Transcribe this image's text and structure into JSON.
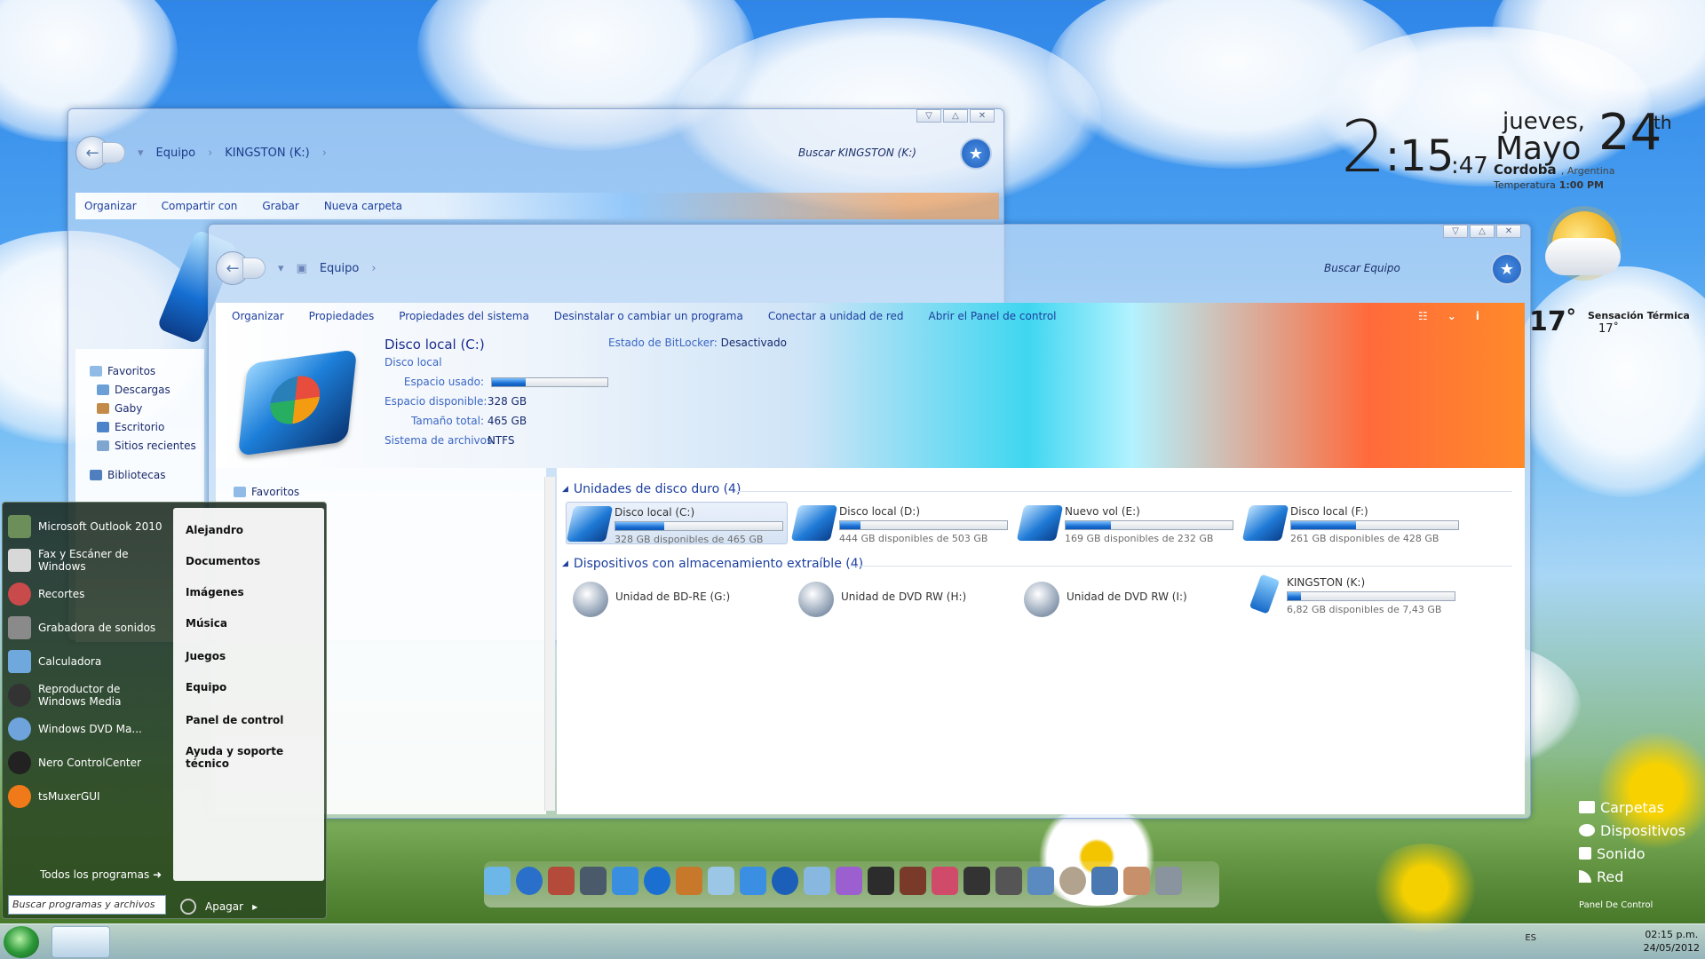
{
  "clock": {
    "hour": "2",
    "minsec": ":15",
    "sec": ":47",
    "day_name": "jueves,",
    "month": "Mayo",
    "day_num": "24",
    "suffix": "th",
    "city": "Cordoba",
    "country": ", Argentina",
    "temp_label": "Temperatura",
    "temp_time": "1:00 PM"
  },
  "weather": {
    "temp": "17",
    "deg": "°",
    "feels_label": "Sensación Térmica",
    "feels_value": "17˚"
  },
  "quicklinks": {
    "items": [
      "Carpetas",
      "Dispositivos",
      "Sonido",
      "Red"
    ],
    "panel": "Panel De Control"
  },
  "win_kingston": {
    "crumbs": [
      "Equipo",
      "KINGSTON (K:)"
    ],
    "search": "Buscar KINGSTON (K:)",
    "cmd": [
      "Organizar",
      "Compartir con",
      "Grabar",
      "Nueva carpeta"
    ],
    "side_groups": [
      {
        "label": "Favoritos",
        "items": [
          "Descargas",
          "Gaby",
          "Escritorio",
          "Sitios recientes"
        ]
      },
      {
        "label": "Bibliotecas"
      }
    ]
  },
  "win_equipo": {
    "crumbs": [
      "Equipo"
    ],
    "search": "Buscar Equipo",
    "cmd": [
      "Organizar",
      "Propiedades",
      "Propiedades del sistema",
      "Desinstalar o cambiar un programa",
      "Conectar a unidad de red",
      "Abrir el Panel de control"
    ],
    "details": {
      "title": "Disco local (C:)",
      "subtitle": "Disco local",
      "used_label": "Espacio usado:",
      "used_fraction": 0.29,
      "free_label": "Espacio disponible:",
      "free_value": "328 GB",
      "total_label": "Tamaño total:",
      "total_value": "465 GB",
      "fs_label": "Sistema de archivos:",
      "fs_value": "NTFS",
      "bitlocker_label": "Estado de BitLocker:",
      "bitlocker_value": "Desactivado"
    },
    "side_fav": "Favoritos",
    "group1": "Unidades de disco duro (4)",
    "group2": "Dispositivos con almacenamiento extraíble (4)",
    "drives": [
      {
        "name": "Disco local (C:)",
        "info": "328 GB disponibles de 465 GB",
        "used": 0.29
      },
      {
        "name": "Disco local (D:)",
        "info": "444 GB disponibles de 503 GB",
        "used": 0.12
      },
      {
        "name": "Nuevo vol (E:)",
        "info": "169 GB disponibles de 232 GB",
        "used": 0.27
      },
      {
        "name": "Disco local (F:)",
        "info": "261 GB disponibles de 428 GB",
        "used": 0.39
      }
    ],
    "removable": [
      {
        "name": "Unidad de BD-RE (G:)"
      },
      {
        "name": "Unidad de DVD RW (H:)"
      },
      {
        "name": "Unidad de DVD RW (I:)"
      },
      {
        "name": "KINGSTON (K:)",
        "info": "6,82 GB disponibles de 7,43 GB",
        "used": 0.08
      }
    ]
  },
  "start_menu": {
    "programs": [
      "Microsoft Outlook 2010",
      "Fax y Escáner de Windows",
      "Recortes",
      "Grabadora de sonidos",
      "Calculadora",
      "Reproductor de Windows Media",
      "Windows DVD Ma...",
      "Nero ControlCenter",
      "tsMuxerGUI"
    ],
    "right": [
      "Alejandro",
      "Documentos",
      "Imágenes",
      "Música",
      "Juegos",
      "Equipo",
      "Panel de control",
      "Ayuda y soporte técnico"
    ],
    "all_programs": "Todos los programas",
    "search_placeholder": "Buscar programas y archivos",
    "shutdown": "Apagar"
  },
  "taskbar": {
    "lang": "ES",
    "time": "02:15 p.m.",
    "date": "24/05/2012"
  },
  "colors": {
    "accent": "#1c3f9e",
    "bar_fill": "#1b6fd3"
  }
}
